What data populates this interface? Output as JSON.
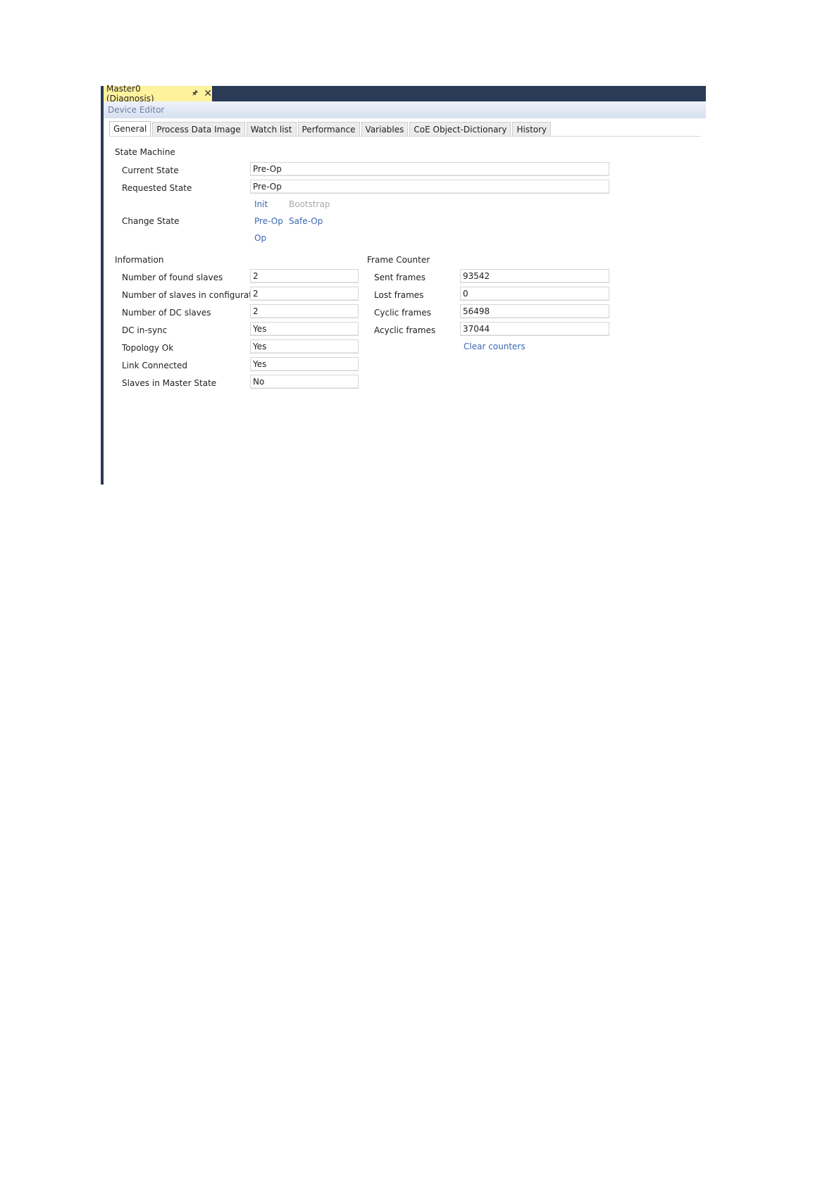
{
  "window": {
    "doc_tab_title": "Master0 (Diagnosis)",
    "pin_icon": "pin-icon",
    "close_icon": "close-icon",
    "editor_title": "Device Editor"
  },
  "tabs": [
    {
      "label": "General",
      "active": true
    },
    {
      "label": "Process Data Image"
    },
    {
      "label": "Watch list"
    },
    {
      "label": "Performance"
    },
    {
      "label": "Variables"
    },
    {
      "label": "CoE Object-Dictionary"
    },
    {
      "label": "History"
    }
  ],
  "state_machine": {
    "title": "State Machine",
    "current_state_label": "Current State",
    "current_state_value": "Pre-Op",
    "requested_state_label": "Requested State",
    "requested_state_value": "Pre-Op",
    "change_state_label": "Change State",
    "buttons": {
      "init": "Init",
      "bootstrap": "Bootstrap",
      "preop": "Pre-Op",
      "safeop": "Safe-Op",
      "op": "Op"
    }
  },
  "information": {
    "title": "Information",
    "rows": [
      {
        "label": "Number of found slaves",
        "value": "2"
      },
      {
        "label": "Number of slaves in configuration",
        "value": "2"
      },
      {
        "label": "Number of DC slaves",
        "value": "2"
      },
      {
        "label": "DC in-sync",
        "value": "Yes"
      },
      {
        "label": "Topology Ok",
        "value": "Yes"
      },
      {
        "label": "Link Connected",
        "value": "Yes"
      },
      {
        "label": "Slaves in Master State",
        "value": "No"
      }
    ]
  },
  "frame_counter": {
    "title": "Frame Counter",
    "rows": [
      {
        "label": "Sent frames",
        "value": "93542"
      },
      {
        "label": "Lost frames",
        "value": "0"
      },
      {
        "label": "Cyclic frames",
        "value": "56498"
      },
      {
        "label": "Acyclic frames",
        "value": "37044"
      }
    ],
    "clear_label": "Clear counters"
  },
  "colors": {
    "titlebar": "#2b3a55",
    "doc_tab": "#fff29d",
    "link": "#3a67b3"
  }
}
